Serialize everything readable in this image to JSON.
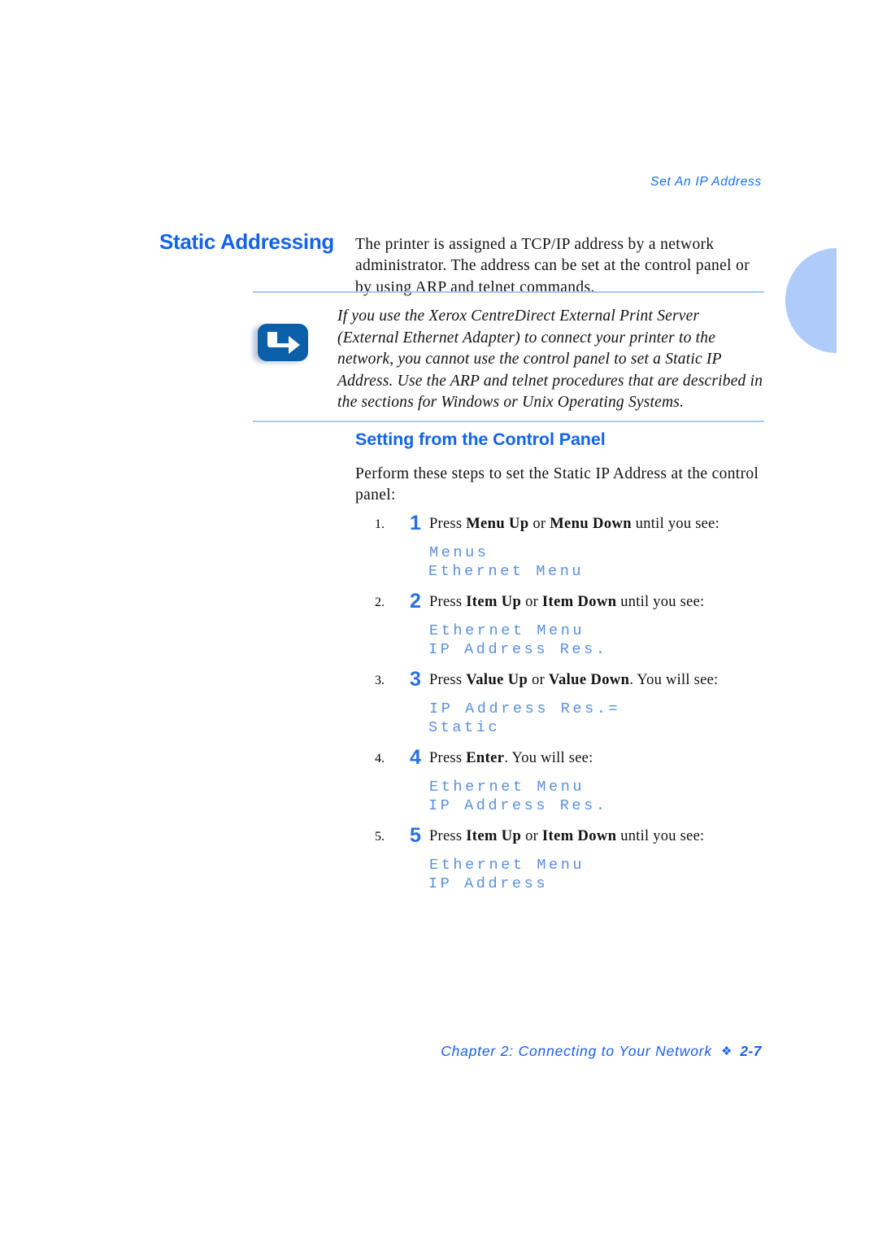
{
  "document": {
    "running_header": "Set An IP Address",
    "section_heading": "Static Addressing",
    "intro_paragraph": "The printer is assigned a TCP/IP address by a network administrator. The address can be set at the control panel or by using ARP and telnet commands.",
    "note": {
      "icon": "note-arrow-icon",
      "text": "If you use the Xerox CentreDirect External Print Server (External Ethernet Adapter) to connect your printer to the network, you cannot use the control panel to set a Static IP Address. Use the ARP and telnet procedures that are described in the sections for Windows or Unix Operating Systems."
    },
    "sub_heading": "Setting from the Control Panel",
    "lead_paragraph": "Perform these steps to set the Static IP Address at the control panel:",
    "steps": [
      {
        "number": "1",
        "prefix": "Press ",
        "key1": "Menu Up",
        "conjunction": " or ",
        "key2": "Menu Down",
        "suffix": " until you see:",
        "display_line1": "Menus",
        "display_line2": "Ethernet Menu"
      },
      {
        "number": "2",
        "prefix": "Press ",
        "key1": "Item Up",
        "conjunction": " or ",
        "key2": "Item Down",
        "suffix": " until you see:",
        "display_line1": "Ethernet Menu",
        "display_line2": "IP Address Res."
      },
      {
        "number": "3",
        "prefix": "Press ",
        "key1": "Value Up",
        "conjunction": " or ",
        "key2": "Value Down",
        "suffix": ". You will see:",
        "display_line1": "IP Address Res.=",
        "display_line2": "Static"
      },
      {
        "number": "4",
        "prefix": "Press ",
        "key1": "Enter",
        "conjunction": "",
        "key2": "",
        "suffix": ". You will see:",
        "display_line1": "Ethernet Menu",
        "display_line2": "IP Address Res."
      },
      {
        "number": "5",
        "prefix": "Press ",
        "key1": "Item Up",
        "conjunction": " or ",
        "key2": "Item Down",
        "suffix": " until you see:",
        "display_line1": "Ethernet Menu",
        "display_line2": "IP Address"
      }
    ],
    "footer": {
      "chapter": "Chapter 2: Connecting to Your Network",
      "separator": "❖",
      "page_number": "2-7"
    },
    "colors": {
      "heading_blue": "#1262f0",
      "header_blue": "#1a6ef5",
      "panel_text_blue": "#5a8fe0",
      "step_number_blue": "#2a6fe0",
      "rule_blue": "#a8c8f5",
      "tab_blue": "#aecbfa",
      "note_icon_blue": "#0a5fa8"
    }
  }
}
